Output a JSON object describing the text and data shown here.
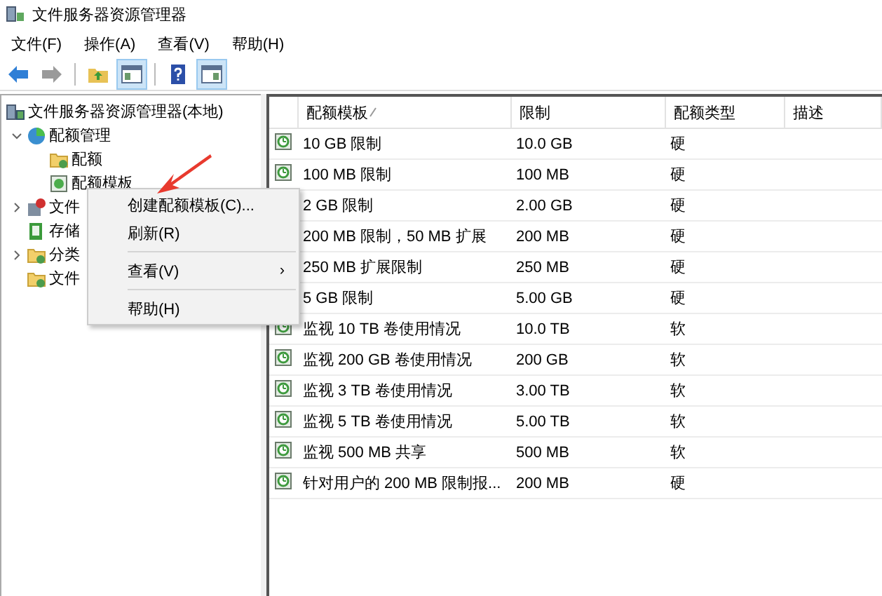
{
  "window": {
    "title": "文件服务器资源管理器"
  },
  "menu_bar": [
    "文件(F)",
    "操作(A)",
    "查看(V)",
    "帮助(H)"
  ],
  "toolbar": [
    {
      "kind": "back",
      "selected": false
    },
    {
      "kind": "forward",
      "selected": false
    },
    {
      "kind": "up",
      "selected": false
    },
    {
      "kind": "tree",
      "selected": true
    },
    {
      "kind": "help",
      "selected": false
    },
    {
      "kind": "panel",
      "selected": true
    }
  ],
  "tree": {
    "label": "文件服务器资源管理器(本地)",
    "kind": "server",
    "children": [
      {
        "label": "配额管理",
        "kind": "quota",
        "expanded": true,
        "children": [
          {
            "label": "配额",
            "kind": "folder"
          },
          {
            "label": "配额模板",
            "kind": "template"
          }
        ]
      },
      {
        "label": "文件",
        "kind": "screen",
        "expanded": false
      },
      {
        "label": "存储",
        "kind": "report"
      },
      {
        "label": "分类",
        "kind": "folder",
        "expanded": false
      },
      {
        "label": "文件",
        "kind": "folder"
      }
    ]
  },
  "table": {
    "columns": [
      "配额模板",
      "限制",
      "配额类型",
      "描述"
    ],
    "rows": [
      {
        "cells": [
          "10 GB 限制",
          "10.0 GB",
          "硬"
        ]
      },
      {
        "cells": [
          "100 MB 限制",
          "100 MB",
          "硬"
        ]
      },
      {
        "cells": [
          "2 GB 限制",
          "2.00 GB",
          "硬"
        ]
      },
      {
        "cells": [
          "200 MB 限制，50 MB 扩展",
          "200 MB",
          "硬"
        ]
      },
      {
        "cells": [
          "250 MB 扩展限制",
          "250 MB",
          "硬"
        ]
      },
      {
        "cells": [
          "5 GB 限制",
          "5.00 GB",
          "硬"
        ]
      },
      {
        "cells": [
          "监视 10 TB 卷使用情况",
          "10.0 TB",
          "软"
        ]
      },
      {
        "cells": [
          "监视 200 GB 卷使用情况",
          "200 GB",
          "软"
        ]
      },
      {
        "cells": [
          "监视 3 TB 卷使用情况",
          "3.00 TB",
          "软"
        ]
      },
      {
        "cells": [
          "监视 5 TB 卷使用情况",
          "5.00 TB",
          "软"
        ]
      },
      {
        "cells": [
          "监视 500 MB 共享",
          "500 MB",
          "软"
        ]
      },
      {
        "cells": [
          "针对用户的 200 MB 限制报...",
          "200 MB",
          "硬"
        ]
      }
    ]
  },
  "context_menu": [
    {
      "kind": "item",
      "label": "创建配额模板(C)..."
    },
    {
      "kind": "item",
      "label": "刷新(R)"
    },
    {
      "kind": "separator"
    },
    {
      "kind": "submenu",
      "label": "查看(V)",
      "arrow": "›"
    },
    {
      "kind": "separator"
    },
    {
      "kind": "item",
      "label": "帮助(H)"
    }
  ]
}
